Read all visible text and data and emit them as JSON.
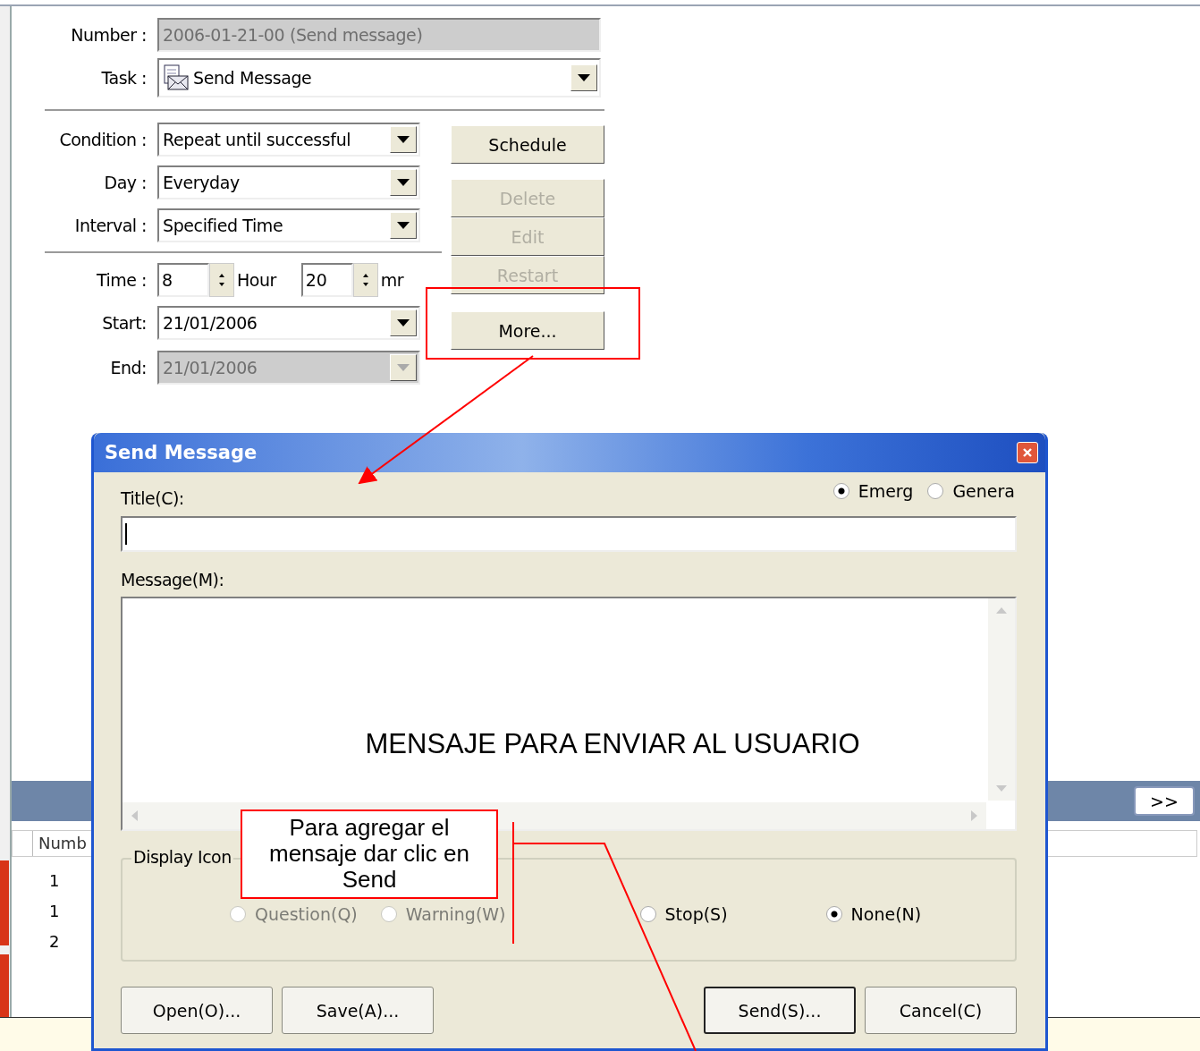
{
  "schedule_form": {
    "number": {
      "label": "Number :",
      "value": "2006-01-21-00 (Send message)",
      "disabled": true
    },
    "task": {
      "label": "Task :",
      "value": "Send Message"
    },
    "condition": {
      "label": "Condition :",
      "value": "Repeat until successful",
      "disabled": false
    },
    "day": {
      "label": "Day :",
      "value": "Everyday",
      "disabled": false
    },
    "interval": {
      "label": "Interval :",
      "value": "Specified Time",
      "disabled": false
    },
    "time": {
      "label": "Time :",
      "hour": "8",
      "hour_unit": "Hour",
      "minute": "20",
      "minute_unit": "mr"
    },
    "start": {
      "label": "Start:",
      "value": "21/01/2006",
      "disabled": false
    },
    "end": {
      "label": "End:",
      "value": "21/01/2006",
      "disabled": true
    },
    "buttons": [
      {
        "label": "Schedule",
        "disabled": false
      },
      {
        "label": "Delete",
        "disabled": true
      },
      {
        "label": "Edit",
        "disabled": true
      },
      {
        "label": "Restart",
        "disabled": true
      },
      {
        "label": "More...",
        "disabled": false
      }
    ]
  },
  "list_toolbar": {
    "button": ">>"
  },
  "list": {
    "columns": [
      "Numb"
    ],
    "rows": [
      [
        "1"
      ],
      [
        "1"
      ],
      [
        "2"
      ]
    ]
  },
  "dialog": {
    "title": "Send Message",
    "priority": [
      {
        "label": "Emerg",
        "selected": true
      },
      {
        "label": "Genera",
        "selected": false
      }
    ],
    "title_label": "Title(C):",
    "message_label": "Message(M):",
    "display_icon": {
      "legend": "Display Icon",
      "options": [
        {
          "label": "Question(Q)",
          "selected": false,
          "disabled": true
        },
        {
          "label": "Warning(W)",
          "selected": false,
          "disabled": true
        },
        {
          "label": "Stop(S)",
          "selected": false,
          "disabled": false
        },
        {
          "label": "None(N)",
          "selected": true,
          "disabled": false
        }
      ]
    },
    "buttons": [
      {
        "label": "Open(O)...",
        "default": false
      },
      {
        "label": "Save(A)...",
        "default": false
      },
      {
        "label": "Send(S)...",
        "default": true
      },
      {
        "label": "Cancel(C)",
        "default": false
      }
    ]
  },
  "annotations": {
    "message_note": "MENSAJE PARA ENVIAR AL USUARIO",
    "callout": "Para agregar el mensaje dar clic en Send"
  }
}
